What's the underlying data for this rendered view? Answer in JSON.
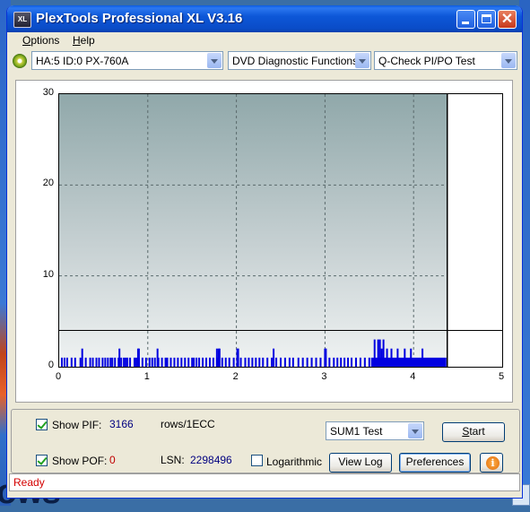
{
  "window": {
    "title": "PlexTools Professional XL V3.16",
    "icon_text": "XL"
  },
  "menu": [
    "Options",
    "Help"
  ],
  "toolbar": {
    "drive": "HA:5 ID:0  PX-760A",
    "function": "DVD Diagnostic Functions",
    "test": "Q-Check PI/PO Test"
  },
  "chart_data": {
    "type": "bar",
    "title": "",
    "xlabel": "",
    "ylabel": "",
    "xlim": [
      0,
      5
    ],
    "ylim": [
      0,
      30
    ],
    "x_ticks": [
      "0",
      "1",
      "2",
      "3",
      "4",
      "5"
    ],
    "y_ticks": [
      "0",
      "10",
      "20",
      "30"
    ],
    "grid": true,
    "threshold": 4,
    "end_marker": 4.38,
    "bar_color": "#0000e0",
    "series": [
      {
        "x": [
          0.03,
          0.06,
          0.09,
          0.14,
          0.18,
          0.24,
          0.26,
          0.3,
          0.35,
          0.38,
          0.42,
          0.45,
          0.49,
          0.52,
          0.55,
          0.58,
          0.6,
          0.63,
          0.67,
          0.7,
          0.73,
          0.75,
          0.77,
          0.8,
          0.85,
          0.87,
          0.9,
          0.94,
          0.98,
          1.02,
          1.05,
          1.08,
          1.12,
          1.16,
          1.2,
          1.22,
          1.26,
          1.3,
          1.34,
          1.38,
          1.42,
          1.46,
          1.5,
          1.52,
          1.55,
          1.58,
          1.62,
          1.66,
          1.7,
          1.74,
          1.78,
          1.8,
          1.84,
          1.88,
          1.92,
          1.97,
          2.01,
          2.05,
          2.1,
          2.14,
          2.18,
          2.22,
          2.26,
          2.3,
          2.35,
          2.4,
          2.45,
          2.5,
          2.55,
          2.6,
          2.64,
          2.7,
          2.75,
          2.8,
          2.85,
          2.9,
          2.95,
          3.0,
          3.05,
          3.1,
          3.14,
          3.18,
          3.22,
          3.26,
          3.3,
          3.35,
          3.4,
          3.45,
          3.5
        ],
        "values": [
          1,
          1,
          1,
          1,
          1,
          1,
          2,
          1,
          1,
          1,
          1,
          1,
          1,
          1,
          1,
          1,
          1,
          1,
          1,
          1,
          1,
          1,
          1,
          1,
          1,
          1,
          1,
          1,
          1,
          1,
          1,
          1,
          1,
          1,
          1,
          1,
          1,
          1,
          1,
          1,
          1,
          1,
          1,
          1,
          1,
          1,
          1,
          1,
          1,
          1,
          1,
          1,
          1,
          1,
          1,
          1,
          1,
          1,
          1,
          1,
          1,
          1,
          1,
          1,
          1,
          1,
          1,
          1,
          1,
          1,
          1,
          1,
          1,
          1,
          1,
          1,
          1,
          1,
          1,
          1,
          1,
          1,
          1,
          1,
          1,
          1,
          1,
          1,
          1
        ]
      }
    ],
    "spikes": {
      "x": [
        0.68,
        0.9,
        0.89,
        1.11,
        1.78,
        1.8,
        1.81,
        2.01,
        2.02,
        2.42,
        3.0,
        3.01
      ],
      "values": [
        2,
        2,
        2,
        2,
        2,
        2,
        2,
        2,
        2,
        2,
        2,
        2
      ]
    },
    "dense_region": {
      "x_start": 3.52,
      "x_end": 4.37,
      "base_value": 1,
      "peaks_x": [
        3.56,
        3.6,
        3.62,
        3.64,
        3.66,
        3.7,
        3.75,
        3.82,
        3.9,
        3.97,
        4.1
      ],
      "peaks_values": [
        3,
        3,
        3,
        2,
        3,
        2,
        2,
        2,
        2,
        2,
        2
      ]
    }
  },
  "panel": {
    "show_pif_label": "Show PIF:",
    "pif_value": "3166",
    "rows_label": "rows/1ECC",
    "show_pof_label": "Show POF:",
    "pof_value": "0",
    "lsn_label": "LSN:",
    "lsn_value": "2298496",
    "logarithmic_label": "Logarithmic",
    "sum_select": "SUM1 Test",
    "start_label": "Start",
    "view_log_label": "View Log",
    "preferences_label": "Preferences",
    "info_glyph": "i"
  },
  "status": {
    "text": "Ready",
    "color": "#d40000"
  },
  "desktop": {
    "fragment_text": "ows"
  }
}
